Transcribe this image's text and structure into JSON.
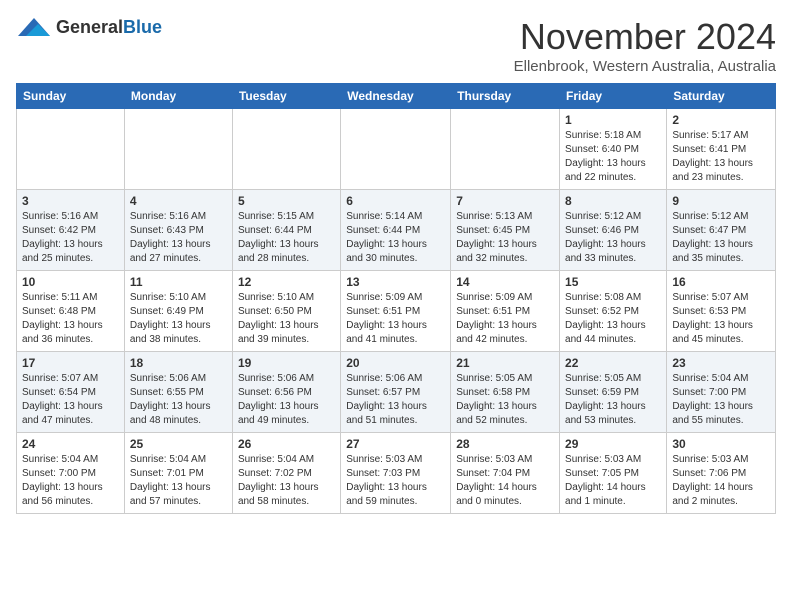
{
  "logo": {
    "general": "General",
    "blue": "Blue"
  },
  "title": "November 2024",
  "subtitle": "Ellenbrook, Western Australia, Australia",
  "days_of_week": [
    "Sunday",
    "Monday",
    "Tuesday",
    "Wednesday",
    "Thursday",
    "Friday",
    "Saturday"
  ],
  "weeks": [
    [
      {
        "day": "",
        "detail": ""
      },
      {
        "day": "",
        "detail": ""
      },
      {
        "day": "",
        "detail": ""
      },
      {
        "day": "",
        "detail": ""
      },
      {
        "day": "",
        "detail": ""
      },
      {
        "day": "1",
        "detail": "Sunrise: 5:18 AM\nSunset: 6:40 PM\nDaylight: 13 hours\nand 22 minutes."
      },
      {
        "day": "2",
        "detail": "Sunrise: 5:17 AM\nSunset: 6:41 PM\nDaylight: 13 hours\nand 23 minutes."
      }
    ],
    [
      {
        "day": "3",
        "detail": "Sunrise: 5:16 AM\nSunset: 6:42 PM\nDaylight: 13 hours\nand 25 minutes."
      },
      {
        "day": "4",
        "detail": "Sunrise: 5:16 AM\nSunset: 6:43 PM\nDaylight: 13 hours\nand 27 minutes."
      },
      {
        "day": "5",
        "detail": "Sunrise: 5:15 AM\nSunset: 6:44 PM\nDaylight: 13 hours\nand 28 minutes."
      },
      {
        "day": "6",
        "detail": "Sunrise: 5:14 AM\nSunset: 6:44 PM\nDaylight: 13 hours\nand 30 minutes."
      },
      {
        "day": "7",
        "detail": "Sunrise: 5:13 AM\nSunset: 6:45 PM\nDaylight: 13 hours\nand 32 minutes."
      },
      {
        "day": "8",
        "detail": "Sunrise: 5:12 AM\nSunset: 6:46 PM\nDaylight: 13 hours\nand 33 minutes."
      },
      {
        "day": "9",
        "detail": "Sunrise: 5:12 AM\nSunset: 6:47 PM\nDaylight: 13 hours\nand 35 minutes."
      }
    ],
    [
      {
        "day": "10",
        "detail": "Sunrise: 5:11 AM\nSunset: 6:48 PM\nDaylight: 13 hours\nand 36 minutes."
      },
      {
        "day": "11",
        "detail": "Sunrise: 5:10 AM\nSunset: 6:49 PM\nDaylight: 13 hours\nand 38 minutes."
      },
      {
        "day": "12",
        "detail": "Sunrise: 5:10 AM\nSunset: 6:50 PM\nDaylight: 13 hours\nand 39 minutes."
      },
      {
        "day": "13",
        "detail": "Sunrise: 5:09 AM\nSunset: 6:51 PM\nDaylight: 13 hours\nand 41 minutes."
      },
      {
        "day": "14",
        "detail": "Sunrise: 5:09 AM\nSunset: 6:51 PM\nDaylight: 13 hours\nand 42 minutes."
      },
      {
        "day": "15",
        "detail": "Sunrise: 5:08 AM\nSunset: 6:52 PM\nDaylight: 13 hours\nand 44 minutes."
      },
      {
        "day": "16",
        "detail": "Sunrise: 5:07 AM\nSunset: 6:53 PM\nDaylight: 13 hours\nand 45 minutes."
      }
    ],
    [
      {
        "day": "17",
        "detail": "Sunrise: 5:07 AM\nSunset: 6:54 PM\nDaylight: 13 hours\nand 47 minutes."
      },
      {
        "day": "18",
        "detail": "Sunrise: 5:06 AM\nSunset: 6:55 PM\nDaylight: 13 hours\nand 48 minutes."
      },
      {
        "day": "19",
        "detail": "Sunrise: 5:06 AM\nSunset: 6:56 PM\nDaylight: 13 hours\nand 49 minutes."
      },
      {
        "day": "20",
        "detail": "Sunrise: 5:06 AM\nSunset: 6:57 PM\nDaylight: 13 hours\nand 51 minutes."
      },
      {
        "day": "21",
        "detail": "Sunrise: 5:05 AM\nSunset: 6:58 PM\nDaylight: 13 hours\nand 52 minutes."
      },
      {
        "day": "22",
        "detail": "Sunrise: 5:05 AM\nSunset: 6:59 PM\nDaylight: 13 hours\nand 53 minutes."
      },
      {
        "day": "23",
        "detail": "Sunrise: 5:04 AM\nSunset: 7:00 PM\nDaylight: 13 hours\nand 55 minutes."
      }
    ],
    [
      {
        "day": "24",
        "detail": "Sunrise: 5:04 AM\nSunset: 7:00 PM\nDaylight: 13 hours\nand 56 minutes."
      },
      {
        "day": "25",
        "detail": "Sunrise: 5:04 AM\nSunset: 7:01 PM\nDaylight: 13 hours\nand 57 minutes."
      },
      {
        "day": "26",
        "detail": "Sunrise: 5:04 AM\nSunset: 7:02 PM\nDaylight: 13 hours\nand 58 minutes."
      },
      {
        "day": "27",
        "detail": "Sunrise: 5:03 AM\nSunset: 7:03 PM\nDaylight: 13 hours\nand 59 minutes."
      },
      {
        "day": "28",
        "detail": "Sunrise: 5:03 AM\nSunset: 7:04 PM\nDaylight: 14 hours\nand 0 minutes."
      },
      {
        "day": "29",
        "detail": "Sunrise: 5:03 AM\nSunset: 7:05 PM\nDaylight: 14 hours\nand 1 minute."
      },
      {
        "day": "30",
        "detail": "Sunrise: 5:03 AM\nSunset: 7:06 PM\nDaylight: 14 hours\nand 2 minutes."
      }
    ]
  ]
}
